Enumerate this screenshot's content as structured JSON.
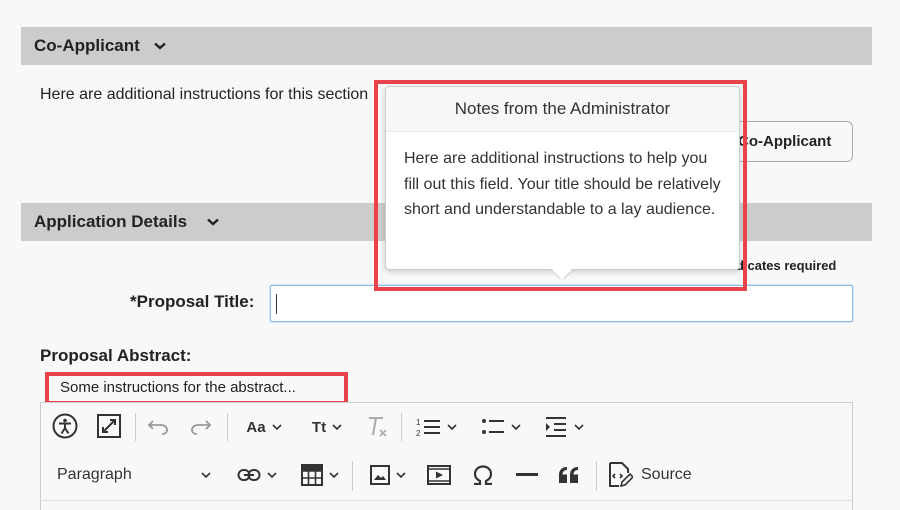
{
  "coapplicant": {
    "title": "Co-Applicant",
    "instructions": "Here are additional instructions for this section",
    "add_button": "Co-Applicant"
  },
  "details": {
    "title": "Application Details",
    "required_note": "ndicates required",
    "proposal_title_label": "*Proposal Title:",
    "proposal_title_value": "",
    "abstract_label": "Proposal Abstract:",
    "abstract_instructions": "Some instructions for the abstract..."
  },
  "tooltip": {
    "title": "Notes from the Administrator",
    "body": "Here are additional instructions to help you fill out this field. Your title should be relatively short and understandable to a lay audience."
  },
  "editor": {
    "paragraph_label": "Paragraph",
    "source_label": "Source",
    "font_family_label": "Aa",
    "font_size_label": "Tt",
    "icons": [
      "accessibility-icon",
      "expand-icon",
      "undo-icon",
      "redo-icon",
      "font-family-icon",
      "font-size-icon",
      "clear-format-icon",
      "numbered-list-icon",
      "bullet-list-icon",
      "indent-icon",
      "link-icon",
      "table-icon",
      "image-icon",
      "media-icon",
      "omega-icon",
      "horizontal-line-icon",
      "blockquote-icon",
      "source-icon"
    ]
  },
  "colors": {
    "highlight": "#e8434b",
    "header_bg": "#cccccc",
    "input_focus": "#8fbce0"
  }
}
